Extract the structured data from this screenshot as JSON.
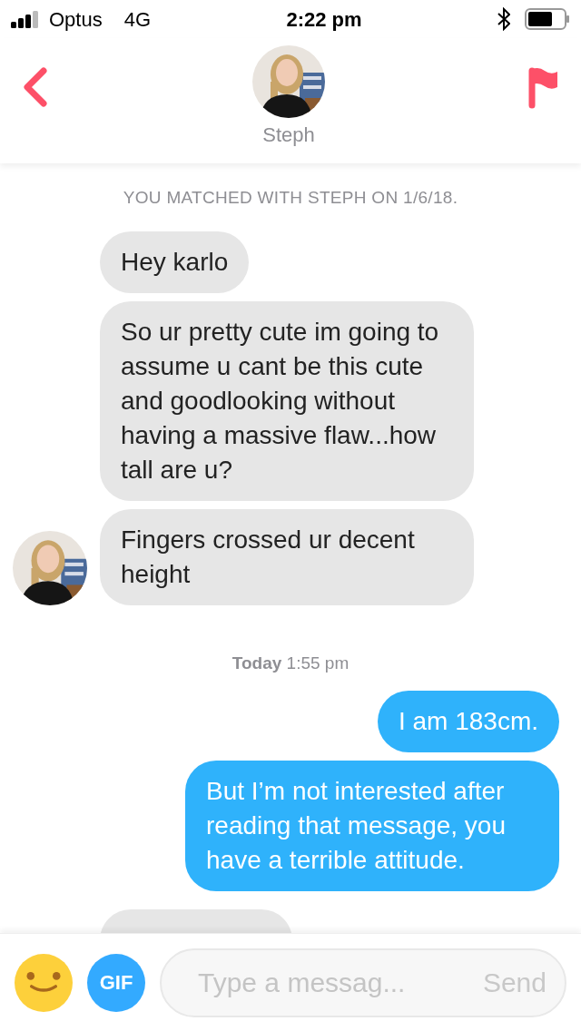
{
  "status_bar": {
    "carrier": "Optus",
    "network": "4G",
    "time": "2:22 pm"
  },
  "header": {
    "name": "Steph"
  },
  "match_notice": "YOU MATCHED WITH STEPH ON 1/6/18.",
  "messages": [
    {
      "kind": "text",
      "outgoing": false,
      "text": "Hey karlo",
      "show_avatar": false
    },
    {
      "kind": "text",
      "outgoing": false,
      "text": "So ur pretty cute im going to assume u cant be this cute and goodlooking without having a massive flaw...how tall are u?",
      "show_avatar": false
    },
    {
      "kind": "text",
      "outgoing": false,
      "text": "Fingers crossed ur decent height",
      "show_avatar": true
    },
    {
      "kind": "date",
      "day": "Today",
      "time": "1:55 pm"
    },
    {
      "kind": "text",
      "outgoing": true,
      "text": "I am 183cm."
    },
    {
      "kind": "text",
      "outgoing": true,
      "text": "But I’m not interested after reading that message, you have a terrible attitude."
    },
    {
      "kind": "partial",
      "outgoing": false
    }
  ],
  "composer": {
    "gif_label": "GIF",
    "placeholder": "Type a messag...",
    "send_label": "Send"
  }
}
